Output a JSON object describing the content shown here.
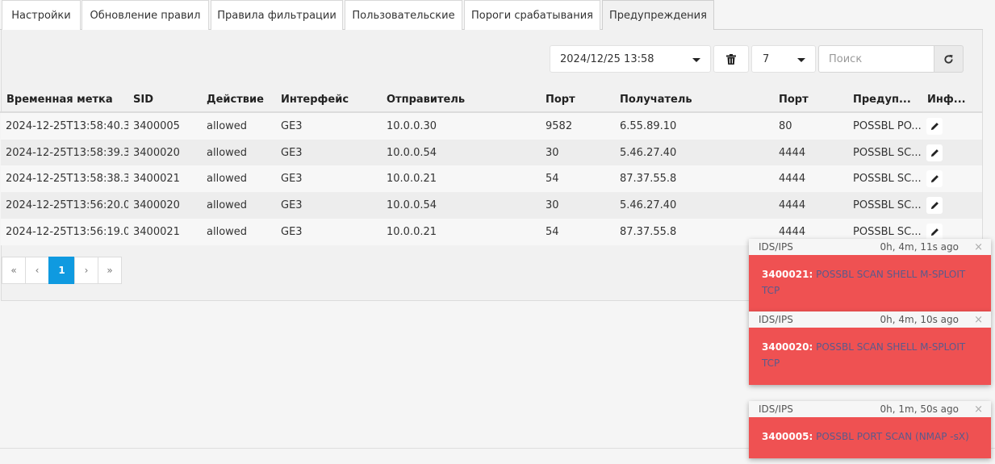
{
  "tabs": [
    {
      "label": "Настройки"
    },
    {
      "label": "Обновление правил"
    },
    {
      "label": "Правила фильтрации"
    },
    {
      "label": "Пользовательские"
    },
    {
      "label": "Пороги срабатывания"
    },
    {
      "label": "Предупреждения"
    }
  ],
  "active_tab": "Предупреждения",
  "toolbar": {
    "datetime": "2024/12/25 13:58",
    "limit": "7",
    "search_placeholder": "Поиск",
    "icons": {
      "trash": "trash-icon",
      "refresh": "refresh-icon"
    }
  },
  "table": {
    "headers": [
      "Временная метка",
      "SID",
      "Действие",
      "Интерфейс",
      "Отправитель",
      "Порт",
      "Получатель",
      "Порт",
      "Предуп...",
      "Инф..."
    ],
    "rows": [
      [
        "2024-12-25T13:58:40.3...",
        "3400005",
        "allowed",
        "GE3",
        "10.0.0.30",
        "9582",
        "6.55.89.10",
        "80",
        "POSSBL PO..."
      ],
      [
        "2024-12-25T13:58:39.3...",
        "3400020",
        "allowed",
        "GE3",
        "10.0.0.54",
        "30",
        "5.46.27.40",
        "4444",
        "POSSBL SC..."
      ],
      [
        "2024-12-25T13:58:38.3...",
        "3400021",
        "allowed",
        "GE3",
        "10.0.0.21",
        "54",
        "87.37.55.8",
        "4444",
        "POSSBL SC..."
      ],
      [
        "2024-12-25T13:56:20.0...",
        "3400020",
        "allowed",
        "GE3",
        "10.0.0.54",
        "30",
        "5.46.27.40",
        "4444",
        "POSSBL SC..."
      ],
      [
        "2024-12-25T13:56:19.0...",
        "3400021",
        "allowed",
        "GE3",
        "10.0.0.21",
        "54",
        "87.37.55.8",
        "4444",
        "POSSBL SC..."
      ]
    ]
  },
  "pagination": {
    "first": "«",
    "prev": "‹",
    "current": "1",
    "next": "›",
    "last": "»"
  },
  "toasts": [
    {
      "title": "IDS/IPS",
      "time": "0h, 4m, 11s ago",
      "close": "×",
      "sid": "3400021:",
      "message": "POSSBL SCAN SHELL M-SPLOIT TCP"
    },
    {
      "title": "IDS/IPS",
      "time": "0h, 4m, 10s ago",
      "close": "×",
      "sid": "3400020:",
      "message": "POSSBL SCAN SHELL M-SPLOIT TCP"
    },
    {
      "title": "IDS/IPS",
      "time": "0h, 1m, 50s ago",
      "close": "×",
      "sid": "3400005:",
      "message": "POSSBL PORT SCAN (NMAP -sX)"
    }
  ],
  "colors": {
    "accent": "#0f9ae0",
    "toast_bg": "#ef5152"
  }
}
